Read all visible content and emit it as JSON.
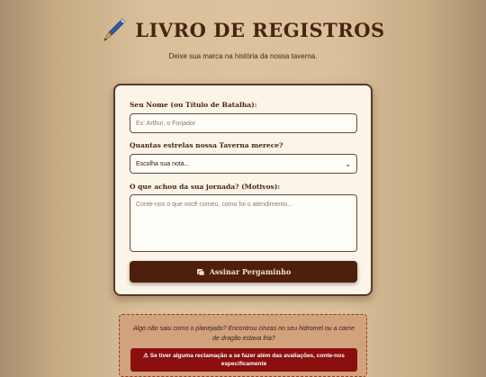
{
  "header": {
    "title": "LIVRO DE REGISTROS",
    "subtitle": "Deixe sua marca na história da nossa taverna."
  },
  "form": {
    "name_label": "Seu Nome (ou Título de Batalha):",
    "name_placeholder": "Ex: Arthur, o Forjador",
    "rating_label": "Quantas estrelas nossa Taverna merece?",
    "rating_selected": "Escolha sua nota...",
    "comment_label": "O que achou da sua jornada? (Motivos):",
    "comment_placeholder": "Conte-nos o que você comeu, como foi o atendimento...",
    "submit_label": "Assinar Pergaminho"
  },
  "warning": {
    "text": "Algo não saiu como o planejado? Encontrou cinzas no seu hidromel ou a carne de dragão estava fria?",
    "button_label": "Se tiver alguma reclamação a se fazer além das avaliações, conte-nos especificamente"
  },
  "icons": {
    "title_icon": "quill-pen-icon",
    "submit_icon": "scroll-icon",
    "warning_icon": "warning-icon",
    "select_icon": "chevron-down-icon"
  },
  "colors": {
    "primary": "#4e1f0c",
    "danger": "#8a0e0e",
    "card_bg": "#fbf5e9"
  }
}
